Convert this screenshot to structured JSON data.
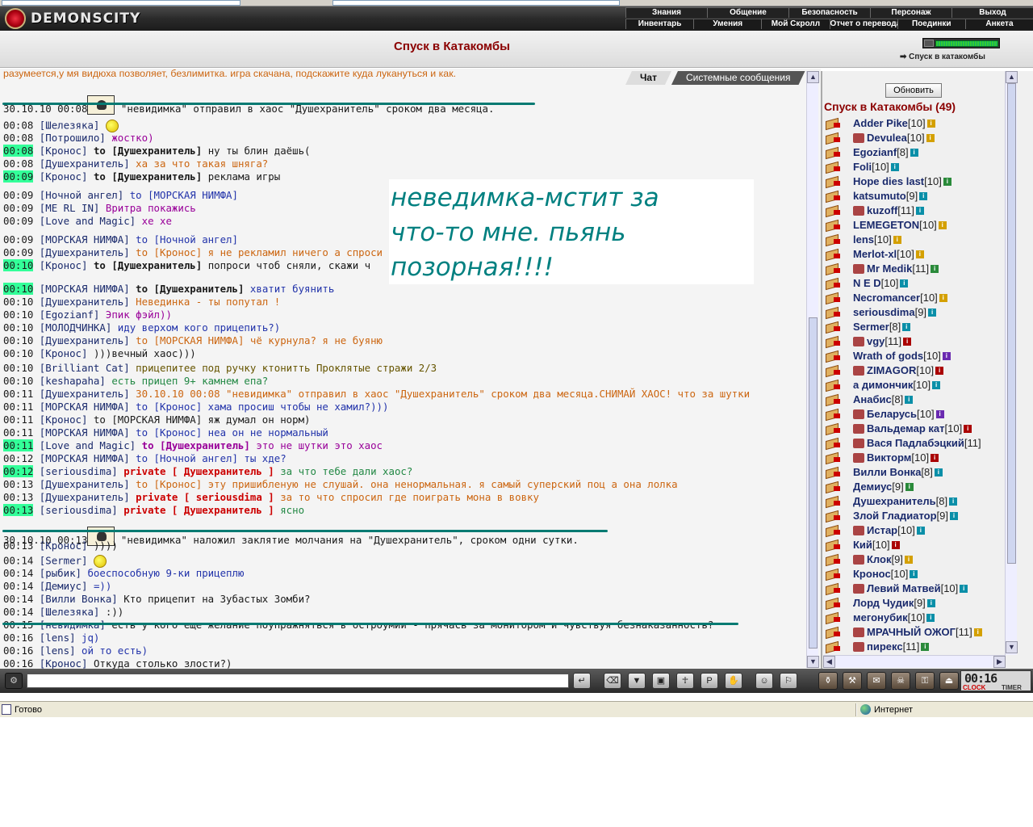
{
  "app": {
    "logo_text": "DEMONSCITY"
  },
  "nav": {
    "row1": [
      "Знания",
      "Общение",
      "Безопасность",
      "Персонаж",
      "Выход"
    ],
    "row2": [
      "Инвентарь",
      "Умения",
      "Мой Скролл",
      "Отчет о переводах",
      "Поединки",
      "Анкета"
    ]
  },
  "location": {
    "title": "Спуск в Катакомбы",
    "descend_link": "Спуск в катакомбы"
  },
  "chat": {
    "tabs": [
      "Чат",
      "Системные сообщения"
    ],
    "top_partial": "разумеется,у мя видюха позволяет, безлимитка. игра скачана, подскажите куда лукануться и как.",
    "messages": [
      {
        "time": "30.10.10 00:08",
        "hl": false,
        "sys": true,
        "text": "\"невидимка\" отправил в хаос \"Душехранитель\" сроком два месяца."
      },
      {
        "time": "00:08",
        "hl": false,
        "nick": "[Шелезяка]",
        "to": "",
        "text": "",
        "cls": "msg-dark"
      },
      {
        "time": "00:08",
        "hl": false,
        "nick": "[Потрошило]",
        "to": "",
        "text": "жостко)",
        "cls": "msg-purple"
      },
      {
        "time": "00:08",
        "hl": true,
        "nick": "[Кронос]",
        "to": "to [Душехранитель]",
        "text": "ну ты блин даёшь(",
        "cls": "msg-dark"
      },
      {
        "time": "00:08",
        "hl": false,
        "nick": "[Душехранитель]",
        "to": "",
        "text": "ха за что такая шняга?",
        "cls": "msg-orange"
      },
      {
        "time": "00:09",
        "hl": true,
        "nick": "[Кронос]",
        "to": "to [Душехранитель]",
        "text": "реклама игры",
        "cls": "msg-dark"
      },
      {
        "time": "00:09",
        "hl": false,
        "nick": "[Ночной ангел]",
        "to": "",
        "text": "to [МОРСКАЯ НИМФА]",
        "cls": "msg-blue"
      },
      {
        "time": "00:09",
        "hl": false,
        "nick": "[ME RL IN]",
        "to": "",
        "text": "Вритра покажись",
        "cls": "msg-purple"
      },
      {
        "time": "00:09",
        "hl": false,
        "nick": "[Love and Magic]",
        "to": "",
        "text": "хе хе",
        "cls": "msg-purple"
      },
      {
        "time": "00:09",
        "hl": false,
        "nick": "[МОРСКАЯ НИМФА]",
        "to": "",
        "text": "to [Ночной ангел]",
        "cls": "msg-blue"
      },
      {
        "time": "00:09",
        "hl": false,
        "nick": "[Душехранитель]",
        "to": "",
        "text": "to [Кронос] я не рекламил ничего а спроси",
        "cls": "msg-orange"
      },
      {
        "time": "00:10",
        "hl": true,
        "nick": "[Кронос]",
        "to": "to [Душехранитель]",
        "text": "попроси чтоб сняли, скажи ч",
        "cls": "msg-dark"
      },
      {
        "time": "00:10",
        "hl": true,
        "nick": "[МОРСКАЯ НИМФА]",
        "to": "to [Душехранитель]",
        "text": "хватит буянить",
        "cls": "msg-blue"
      },
      {
        "time": "00:10",
        "hl": false,
        "nick": "[Душехранитель]",
        "to": "",
        "text": "Невединка - ты попутал !",
        "cls": "msg-orange"
      },
      {
        "time": "00:10",
        "hl": false,
        "nick": "[Egozianf]",
        "to": "",
        "text": "Эпик фэйл))",
        "cls": "msg-purple"
      },
      {
        "time": "00:10",
        "hl": false,
        "nick": "[МОЛОДЧИНКА]",
        "to": "",
        "text": "иду верхом кого прицепить?)",
        "cls": "msg-blue"
      },
      {
        "time": "00:10",
        "hl": false,
        "nick": "[Душехранитель]",
        "to": "",
        "text": "to [МОРСКАЯ НИМФА] чё курнула? я не буяню",
        "cls": "msg-orange"
      },
      {
        "time": "00:10",
        "hl": false,
        "nick": "[Кронос]",
        "to": "",
        "text": ")))вечный хаос)))",
        "cls": "msg-dark"
      },
      {
        "time": "00:10",
        "hl": false,
        "nick": "[Brilliant Cat]",
        "to": "",
        "text": "прицепитее под ручку ктонитть Проклятые стражи 2/3",
        "cls": "msg-olive"
      },
      {
        "time": "00:10",
        "hl": false,
        "nick": "[keshapaha]",
        "to": "",
        "text": "есть прицеп 9+ камнем епа?",
        "cls": "msg-green"
      },
      {
        "time": "00:11",
        "hl": false,
        "nick": "[Душехранитель]",
        "to": "",
        "text": "30.10.10 00:08 \"невидимка\" отправил в хаос \"Душехранитель\" сроком два месяца.СНИМАЙ ХАОС! что за шутки",
        "cls": "msg-orange"
      },
      {
        "time": "00:11",
        "hl": false,
        "nick": "[МОРСКАЯ НИМФА]",
        "to": "",
        "text": "to [Кронос] хама просиш чтобы не хамил?)))",
        "cls": "msg-blue"
      },
      {
        "time": "00:11",
        "hl": false,
        "nick": "[Кронос]",
        "to": "",
        "text": "to [МОРСКАЯ НИМФА] яж думал он норм)",
        "cls": "msg-dark"
      },
      {
        "time": "00:11",
        "hl": false,
        "nick": "[МОРСКАЯ НИМФА]",
        "to": "",
        "text": "to [Кронос] неа он не нормальный",
        "cls": "msg-blue"
      },
      {
        "time": "00:11",
        "hl": true,
        "nick": "[Love and Magic]",
        "to": "to [Душехранитель]",
        "text": "это не шутки это хаос",
        "cls": "msg-purple",
        "to_cls": "msg-purple"
      },
      {
        "time": "00:12",
        "hl": false,
        "nick": "[МОРСКАЯ НИМФА]",
        "to": "",
        "text": "to [Ночной ангел] ты хде?",
        "cls": "msg-blue"
      },
      {
        "time": "00:12",
        "hl": true,
        "nick": "[seriousdima]",
        "priv": "private [ Душехранитель ]",
        "text": "за что тебе дали хаос?",
        "cls": "msg-green"
      },
      {
        "time": "00:13",
        "hl": false,
        "nick": "[Душехранитель]",
        "to": "",
        "text": "to [Кронос] эту пришибленую не слушай. она ненормальная. я самый суперский поц а она лолка",
        "cls": "msg-orange"
      },
      {
        "time": "00:13",
        "hl": false,
        "nick": "[Душехранитель]",
        "priv": "private [ seriousdima ]",
        "text": "за то что спросил где поиграть мона в вовку",
        "cls": "msg-orange"
      },
      {
        "time": "00:13",
        "hl": true,
        "nick": "[seriousdima]",
        "priv": "private [ Душехранитель ]",
        "text": "ясно",
        "cls": "msg-green"
      },
      {
        "time": "30.10.10 00:13",
        "hl": false,
        "sys": true,
        "text": "\"невидимка\" наложил заклятие молчания на \"Душехранитель\", сроком одни сутки."
      },
      {
        "time": "00:13",
        "hl": false,
        "nick": "[Кронос]",
        "to": "",
        "text": "))))",
        "cls": "msg-dark"
      },
      {
        "time": "00:14",
        "hl": false,
        "nick": "[Sermer]",
        "to": "",
        "text": "",
        "cls": "msg-dark"
      },
      {
        "time": "00:14",
        "hl": false,
        "nick": "[рыбик]",
        "to": "",
        "text": "боеспособную 9-ки прицеплю",
        "cls": "msg-blue"
      },
      {
        "time": "00:14",
        "hl": false,
        "nick": "[Демиус]",
        "to": "",
        "text": "=))",
        "cls": "msg-blue"
      },
      {
        "time": "00:14",
        "hl": false,
        "nick": "[Вилли Вонка]",
        "to": "",
        "text": "Кто прицепит на Зубастых Зомби?",
        "cls": "msg-dark"
      },
      {
        "time": "00:14",
        "hl": false,
        "nick": "[Шелезяка]",
        "to": "",
        "text": ":))",
        "cls": "msg-dark"
      },
      {
        "time": "00:15",
        "hl": false,
        "nick": "[невидимка]",
        "to": "",
        "text": "есть у кого еще желание поупражняться в остроумии - прячась за монитором и чувствуя безнаказанность?",
        "cls": "msg-dark"
      },
      {
        "time": "00:16",
        "hl": false,
        "nick": "[lens]",
        "to": "",
        "text": "jq)",
        "cls": "msg-blue"
      },
      {
        "time": "00:16",
        "hl": false,
        "nick": "[lens]",
        "to": "",
        "text": "ой то есть)",
        "cls": "msg-blue"
      },
      {
        "time": "00:16",
        "hl": false,
        "nick": "[Кронос]",
        "to": "",
        "text": "Откуда столько злости?)",
        "cls": "msg-dark"
      }
    ]
  },
  "note": {
    "lines": [
      "неведимка-мстит за",
      "что-то мне. пьянь",
      "позорная!!!!"
    ]
  },
  "sidebar": {
    "refresh_label": "Обновить",
    "room_title": "Спуск в Катакомбы (49)",
    "users": [
      {
        "name": "Adder Pike",
        "lvl": "[10]",
        "b": "y"
      },
      {
        "name": "Devulea",
        "lvl": "[10]",
        "b": "y",
        "clan": true
      },
      {
        "name": "Egozianf",
        "lvl": "[8]",
        "b": "c"
      },
      {
        "name": "Foli",
        "lvl": "[10]",
        "b": "c"
      },
      {
        "name": "Hope dies last",
        "lvl": "[10]",
        "b": "g"
      },
      {
        "name": "katsumuto",
        "lvl": "[9]",
        "b": "c"
      },
      {
        "name": "kuzoff",
        "lvl": "[11]",
        "b": "c",
        "clan": true
      },
      {
        "name": "LEMEGETON",
        "lvl": "[10]",
        "b": "y"
      },
      {
        "name": "lens",
        "lvl": "[10]",
        "b": "y"
      },
      {
        "name": "Merlot-xl",
        "lvl": "[10]",
        "b": "y"
      },
      {
        "name": "Mr Medik",
        "lvl": "[11]",
        "b": "g",
        "clan": true
      },
      {
        "name": "N E D",
        "lvl": "[10]",
        "b": "c"
      },
      {
        "name": "Necromancer",
        "lvl": "[10]",
        "b": "y"
      },
      {
        "name": "seriousdima",
        "lvl": "[9]",
        "b": "c"
      },
      {
        "name": "Sermer",
        "lvl": "[8]",
        "b": "c"
      },
      {
        "name": "vgy",
        "lvl": "[11]",
        "b": "r",
        "clan": true
      },
      {
        "name": "Wrath of gods",
        "lvl": "[10]",
        "b": "p"
      },
      {
        "name": "ZIMAGOR",
        "lvl": "[10]",
        "b": "r",
        "clan": true
      },
      {
        "name": "а димончик",
        "lvl": "[10]",
        "b": "c"
      },
      {
        "name": "Анабис",
        "lvl": "[8]",
        "b": "c"
      },
      {
        "name": "Беларусь",
        "lvl": "[10]",
        "b": "p",
        "clan": true
      },
      {
        "name": "Вальдемар кат",
        "lvl": "[10]",
        "b": "r",
        "clan": true
      },
      {
        "name": "Вася Падлабэцкий",
        "lvl": "[11]",
        "b": "",
        "clan": true
      },
      {
        "name": "Викторм",
        "lvl": "[10]",
        "b": "r",
        "clan": true
      },
      {
        "name": "Вилли Вонка",
        "lvl": "[8]",
        "b": "c"
      },
      {
        "name": "Демиус",
        "lvl": "[9]",
        "b": "g"
      },
      {
        "name": "Душехранитель",
        "lvl": "[8]",
        "b": "c"
      },
      {
        "name": "Злой Гладиатор",
        "lvl": "[9]",
        "b": "c"
      },
      {
        "name": "Истар",
        "lvl": "[10]",
        "b": "c",
        "clan": true
      },
      {
        "name": "Кий",
        "lvl": "[10]",
        "b": "r"
      },
      {
        "name": "Клок",
        "lvl": "[9]",
        "b": "y",
        "clan": true
      },
      {
        "name": "Кронос",
        "lvl": "[10]",
        "b": "c"
      },
      {
        "name": "Левий Матвей",
        "lvl": "[10]",
        "b": "c",
        "clan": true
      },
      {
        "name": "Лорд Чудик",
        "lvl": "[9]",
        "b": "c"
      },
      {
        "name": "мегонубик",
        "lvl": "[10]",
        "b": "c"
      },
      {
        "name": "МРАЧНЫЙ ОЖОГ",
        "lvl": "[11]",
        "b": "y",
        "clan": true
      },
      {
        "name": "пирекс",
        "lvl": "[11]",
        "b": "g",
        "clan": true
      }
    ]
  },
  "clock": {
    "time": "00:16",
    "label1": "CLOCK",
    "label2": "TIMER"
  },
  "status": {
    "left": "Готово",
    "right": "Интернет"
  }
}
